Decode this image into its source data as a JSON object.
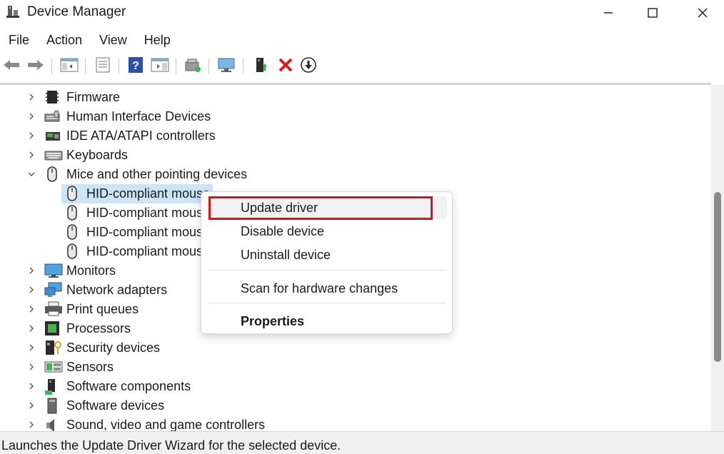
{
  "window": {
    "title": "Device Manager",
    "app_icon": "device-manager-icon",
    "controls": [
      "minimize-icon",
      "maximize-icon",
      "close-icon"
    ]
  },
  "menubar": {
    "items": [
      "File",
      "Action",
      "View",
      "Help"
    ]
  },
  "toolbar": {
    "buttons": [
      "back-arrow-icon",
      "forward-arrow-icon",
      "show-hide-console-tree-icon",
      "properties-icon",
      "help-icon",
      "show-action-pane-icon",
      "scan-hardware-changes-icon",
      "monitor-icon",
      "update-driver-icon",
      "uninstall-device-icon",
      "download-icon"
    ]
  },
  "tree": {
    "items": [
      {
        "label": "Firmware",
        "icon": "firmware-chip-icon",
        "expanded": false,
        "level": 0
      },
      {
        "label": "Human Interface Devices",
        "icon": "hid-icon",
        "expanded": false,
        "level": 0
      },
      {
        "label": "IDE ATA/ATAPI controllers",
        "icon": "ide-controller-icon",
        "expanded": false,
        "level": 0
      },
      {
        "label": "Keyboards",
        "icon": "keyboard-icon",
        "expanded": false,
        "level": 0
      },
      {
        "label": "Mice and other pointing devices",
        "icon": "mouse-icon",
        "expanded": true,
        "level": 0
      },
      {
        "label": "HID-compliant mouse",
        "icon": "mouse-icon",
        "level": 1,
        "selected": true
      },
      {
        "label": "HID-compliant mouse",
        "icon": "mouse-icon",
        "level": 1
      },
      {
        "label": "HID-compliant mouse",
        "icon": "mouse-icon",
        "level": 1
      },
      {
        "label": "HID-compliant mouse",
        "icon": "mouse-icon",
        "level": 1
      },
      {
        "label": "Monitors",
        "icon": "monitor-icon",
        "expanded": false,
        "level": 0
      },
      {
        "label": "Network adapters",
        "icon": "network-adapter-icon",
        "expanded": false,
        "level": 0
      },
      {
        "label": "Print queues",
        "icon": "printer-icon",
        "expanded": false,
        "level": 0
      },
      {
        "label": "Processors",
        "icon": "processor-icon",
        "expanded": false,
        "level": 0
      },
      {
        "label": "Security devices",
        "icon": "security-device-icon",
        "expanded": false,
        "level": 0
      },
      {
        "label": "Sensors",
        "icon": "sensor-icon",
        "expanded": false,
        "level": 0
      },
      {
        "label": "Software components",
        "icon": "software-component-icon",
        "expanded": false,
        "level": 0
      },
      {
        "label": "Software devices",
        "icon": "software-device-icon",
        "expanded": false,
        "level": 0
      },
      {
        "label": "Sound, video and game controllers",
        "icon": "speaker-icon",
        "expanded": false,
        "level": 0
      }
    ]
  },
  "context_menu": {
    "update_driver": "Update driver",
    "disable_device": "Disable device",
    "uninstall_device": "Uninstall device",
    "scan_hardware": "Scan for hardware changes",
    "properties": "Properties",
    "highlight_color": "#d7141a"
  },
  "status_bar": {
    "text": "Launches the Update Driver Wizard for the selected device."
  },
  "colors": {
    "selection": "#cce4f7",
    "hover": "#f2f2f2"
  }
}
